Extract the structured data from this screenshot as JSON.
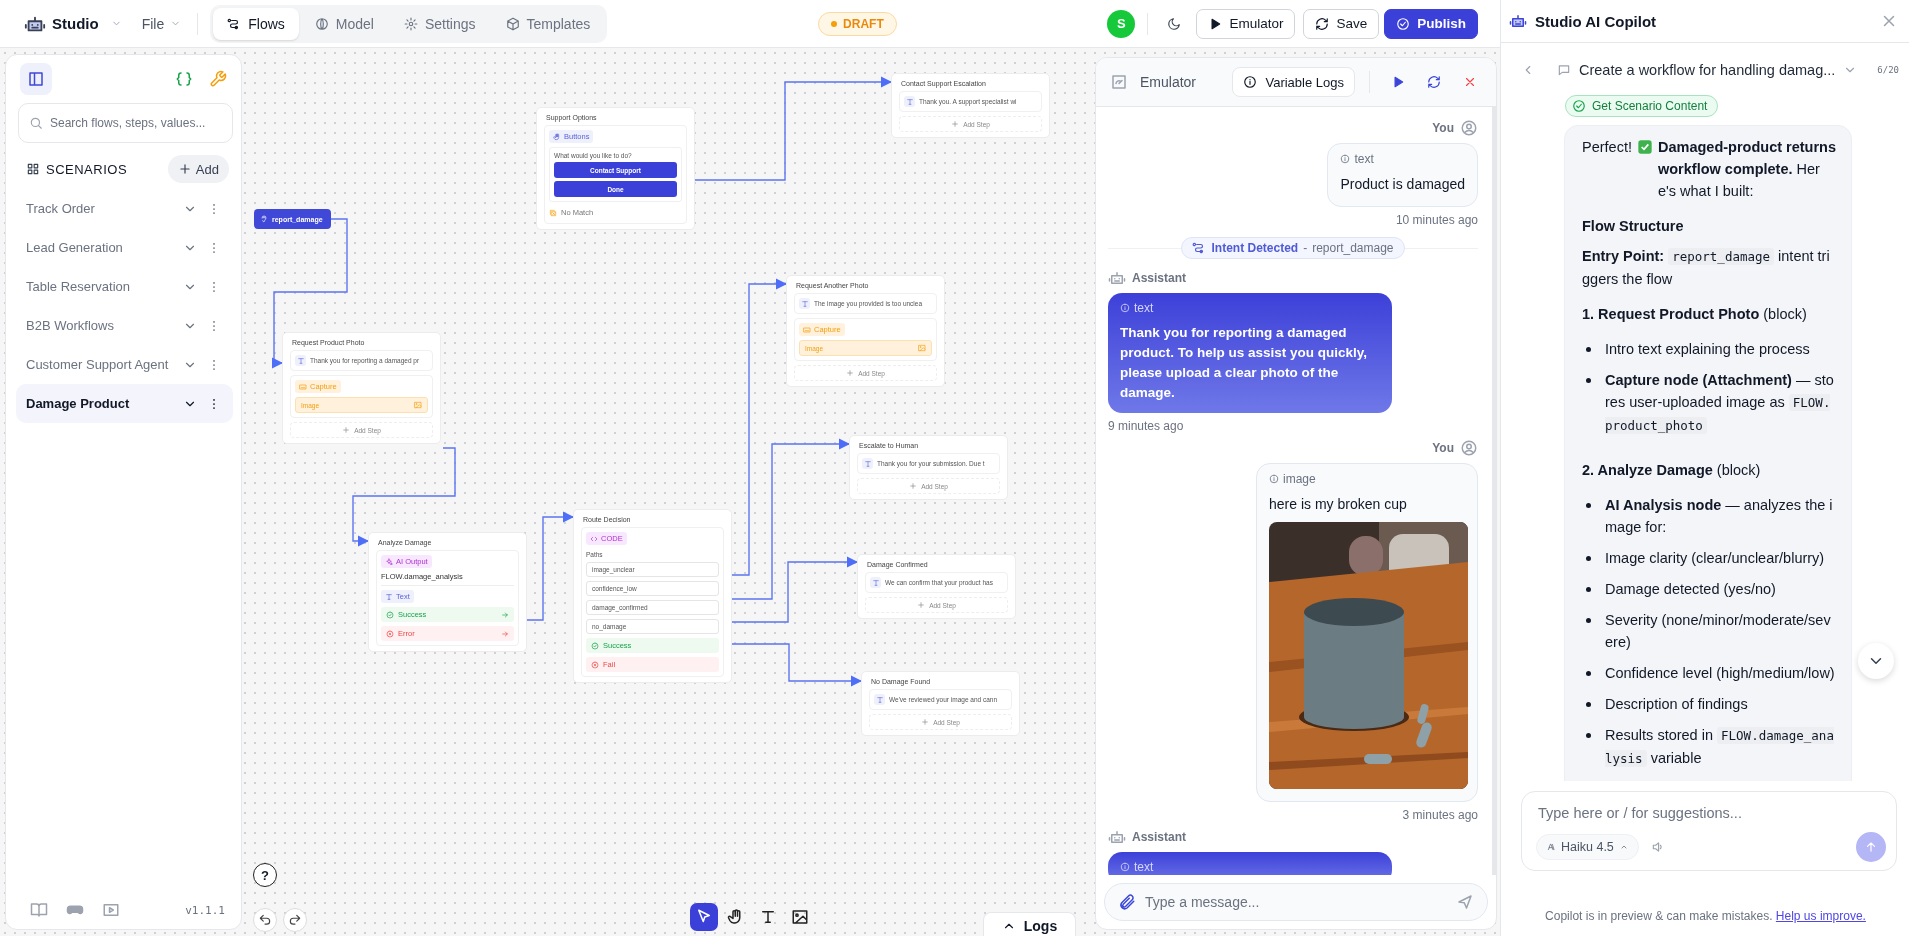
{
  "app": {
    "name": "Studio",
    "menu": "File"
  },
  "tabs": [
    {
      "label": "Flows",
      "selected": true
    },
    {
      "label": "Model",
      "selected": false
    },
    {
      "label": "Settings",
      "selected": false
    },
    {
      "label": "Templates",
      "selected": false
    }
  ],
  "status_badge": "DRAFT",
  "avatar": "S",
  "actions": [
    {
      "label": "Emulator",
      "kind": "outline"
    },
    {
      "label": "Save",
      "kind": "outline"
    },
    {
      "label": "Publish",
      "kind": "primary"
    }
  ],
  "sidebar": {
    "search_placeholder": "Search flows, steps, values...",
    "section": "SCENARIOS",
    "add_label": "Add",
    "scenarios": [
      {
        "label": "Track Order",
        "selected": false
      },
      {
        "label": "Lead Generation",
        "selected": false
      },
      {
        "label": "Table Reservation",
        "selected": false
      },
      {
        "label": "B2B Workflows",
        "selected": false
      },
      {
        "label": "Customer Support Agent",
        "selected": false
      },
      {
        "label": "Damage Product",
        "selected": true
      }
    ],
    "version": "v1.1.1"
  },
  "canvas": {
    "trigger": "report_damage",
    "nodes": [
      {
        "title": "Support Options",
        "steps": [
          {
            "kind": "buttons",
            "badge": "Buttons",
            "prompt": "What would you like to do?",
            "buttons": [
              "Contact Support",
              "Done"
            ],
            "fallback": "No Match"
          }
        ]
      },
      {
        "title": "Contact Support Escalation",
        "steps": [
          {
            "kind": "text",
            "text": "Thank you. A support specialist wi"
          }
        ],
        "add_step": "Add Step"
      },
      {
        "title": "Request Product Photo",
        "steps": [
          {
            "kind": "text",
            "text": "Thank you for reporting a damaged pr"
          },
          {
            "kind": "capture",
            "badge": "Capture",
            "field": "Image"
          }
        ],
        "add_step": "Add Step"
      },
      {
        "title": "Analyze Damage",
        "steps": [
          {
            "kind": "ai_output",
            "badge": "AI Output",
            "variable": "FLOW.damage_analysis",
            "format": "Text",
            "outcomes": [
              {
                "kind": "success",
                "label": "Success"
              },
              {
                "kind": "error",
                "label": "Error"
              }
            ]
          }
        ]
      },
      {
        "title": "Route Decision",
        "steps": [
          {
            "kind": "code",
            "badge": "CODE",
            "paths_label": "Paths",
            "paths": [
              "image_unclear",
              "confidence_low",
              "damage_confirmed",
              "no_damage"
            ],
            "outcomes": [
              {
                "kind": "success",
                "label": "Success"
              },
              {
                "kind": "error",
                "label": "Fail"
              }
            ]
          }
        ]
      },
      {
        "title": "Request Another Photo",
        "steps": [
          {
            "kind": "text",
            "text": "The image you provided is too unclea"
          },
          {
            "kind": "capture",
            "badge": "Capture",
            "field": "Image"
          }
        ],
        "add_step": "Add Step"
      },
      {
        "title": "Escalate to Human",
        "steps": [
          {
            "kind": "text",
            "text": "Thank you for your submission. Due t"
          }
        ],
        "add_step": "Add Step"
      },
      {
        "title": "Damage Confirmed",
        "steps": [
          {
            "kind": "text",
            "text": "We can confirm that your product has"
          }
        ],
        "add_step": "Add Step"
      },
      {
        "title": "No Damage Found",
        "steps": [
          {
            "kind": "text",
            "text": "We've reviewed your image and cann"
          }
        ],
        "add_step": "Add Step"
      }
    ],
    "help": "?",
    "tools": [
      {
        "selected": true
      },
      {
        "selected": false
      },
      {
        "selected": false
      },
      {
        "selected": false
      }
    ],
    "logs": "Logs"
  },
  "emulator": {
    "title": "Emulator",
    "logs_button": "Variable Logs",
    "messages": [
      {
        "kind": "user",
        "sender": "You",
        "type": "text",
        "text": "Product is damaged",
        "time": "10 minutes ago"
      },
      {
        "kind": "intent",
        "label": "Intent Detected",
        "separator": "-",
        "value": "report_damage"
      },
      {
        "kind": "assistant",
        "sender": "Assistant",
        "type": "text",
        "text": "Thank you for reporting a damaged product. To help us assist you quickly, please upload a clear photo of the damage.",
        "time": "9 minutes ago"
      },
      {
        "kind": "user_image",
        "sender": "You",
        "type": "image",
        "text": "here is my broken cup",
        "time": "3 minutes ago"
      },
      {
        "kind": "assistant",
        "sender": "Assistant",
        "type": "text"
      }
    ],
    "input_placeholder": "Type a message..."
  },
  "copilot": {
    "title": "Studio AI Copilot",
    "conversation": {
      "title": "Create a workflow for handling damag...",
      "counter": "6/20"
    },
    "tool_chip": "Get Scenario Content",
    "message": [
      {
        "kind": "p",
        "parts": [
          {
            "kind": "text",
            "text": "Perfect!"
          },
          {
            "kind": "check"
          },
          {
            "kind": "text",
            "text": "**Damaged-product returns workflow complete.** Here's what I built:"
          }
        ]
      },
      {
        "kind": "heading",
        "text": "Flow Structure"
      },
      {
        "kind": "p",
        "parts": [
          {
            "kind": "text",
            "text": "**Entry Point:** "
          },
          {
            "kind": "code",
            "text": "report_damage"
          },
          {
            "kind": "text",
            "text": " intent triggers the flow"
          }
        ]
      },
      {
        "kind": "p",
        "parts": [
          {
            "kind": "text",
            "text": "**1. Request Product Photo** (block)"
          }
        ]
      },
      {
        "kind": "bullet",
        "parts": [
          {
            "kind": "text",
            "text": "Intro text explaining the process"
          }
        ]
      },
      {
        "kind": "bullet",
        "parts": [
          {
            "kind": "text",
            "text": "**Capture node (Attachment)** — stores user-uploaded image as "
          },
          {
            "kind": "code",
            "text": "FLOW.product_photo"
          }
        ]
      },
      {
        "kind": "p",
        "parts": [
          {
            "kind": "text",
            "text": "**2. Analyze Damage** (block)"
          }
        ]
      },
      {
        "kind": "bullet",
        "parts": [
          {
            "kind": "text",
            "text": "**AI Analysis node** — analyzes the image for:"
          }
        ]
      },
      {
        "kind": "bullet",
        "parts": [
          {
            "kind": "text",
            "text": "Image clarity (clear/unclear/blurry)"
          }
        ]
      },
      {
        "kind": "bullet",
        "parts": [
          {
            "kind": "text",
            "text": "Damage detected (yes/no)"
          }
        ]
      },
      {
        "kind": "bullet",
        "parts": [
          {
            "kind": "text",
            "text": "Severity (none/minor/moderate/severe)"
          }
        ]
      },
      {
        "kind": "bullet",
        "parts": [
          {
            "kind": "text",
            "text": "Confidence level (high/medium/low)"
          }
        ]
      },
      {
        "kind": "bullet",
        "parts": [
          {
            "kind": "text",
            "text": "Description of findings"
          }
        ]
      },
      {
        "kind": "bullet",
        "parts": [
          {
            "kind": "text",
            "text": "Results stored in "
          },
          {
            "kind": "code",
            "text": "FLOW.damage_analysis"
          },
          {
            "kind": "text",
            "text": " variable"
          }
        ]
      }
    ],
    "input_placeholder": "Type here or / for suggestions...",
    "model": "Haiku 4.5",
    "footer": {
      "text": "Copilot is in preview & can make mistakes.",
      "link": "Help us improve."
    }
  }
}
